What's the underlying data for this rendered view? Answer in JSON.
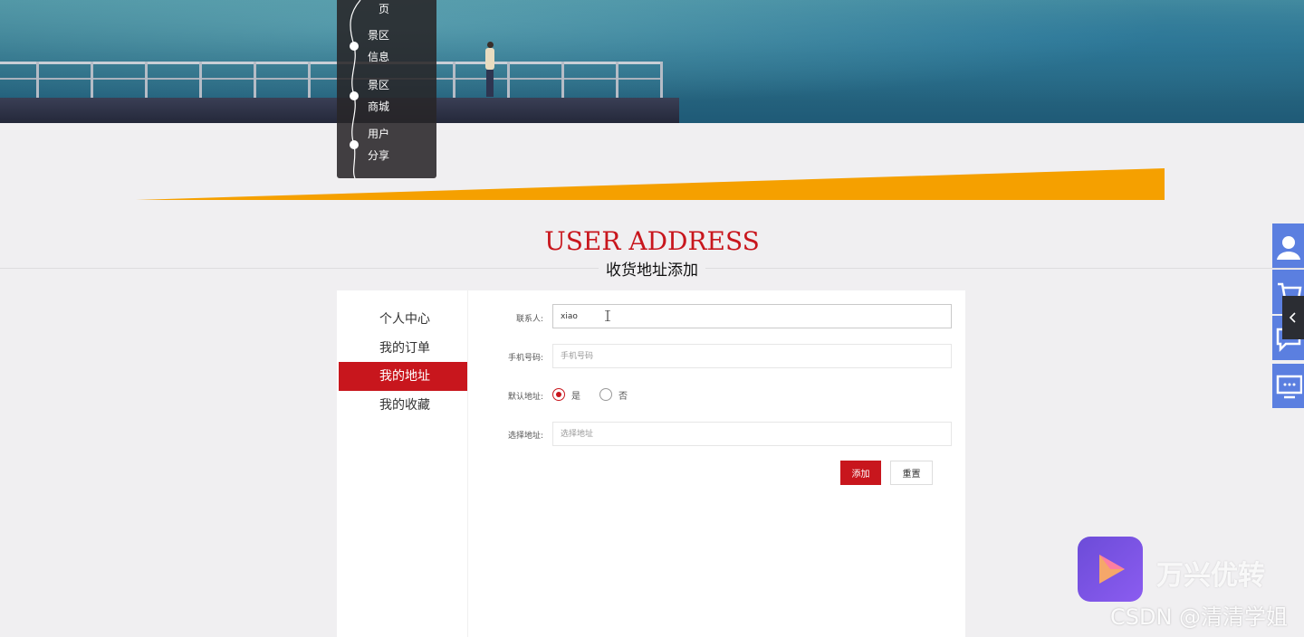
{
  "nav": {
    "items": [
      {
        "label_top": "页",
        "label_bottom": ""
      },
      {
        "label_top": "景区",
        "label_bottom": "信息"
      },
      {
        "label_top": "景区",
        "label_bottom": "商城"
      },
      {
        "label_top": "用户",
        "label_bottom": "分享"
      }
    ]
  },
  "section": {
    "title_en": "USER ADDRESS",
    "title_cn": "收货地址添加"
  },
  "menu": {
    "items": [
      "个人中心",
      "我的订单",
      "我的地址",
      "我的收藏"
    ],
    "active": "我的地址"
  },
  "form": {
    "contact": {
      "label": "联系人:",
      "value": "xiao",
      "placeholder": ""
    },
    "phone": {
      "label": "手机号码:",
      "value": "",
      "placeholder": "手机号码"
    },
    "default": {
      "label": "默认地址:",
      "options": [
        "是",
        "否"
      ],
      "selected": "是"
    },
    "address": {
      "label": "选择地址:",
      "value": "",
      "placeholder": "选择地址"
    },
    "add_label": "添加",
    "reset_label": "重置"
  },
  "float_toolbar": {
    "icons": [
      "user-icon",
      "cart-icon",
      "message-icon",
      "monitor-icon"
    ],
    "collapse_icon": "chevron-left-icon"
  },
  "watermark": {
    "app_name": "万兴优转",
    "csdn": "CSDN @清清学姐"
  },
  "colors": {
    "brand_red": "#c8161d",
    "accent_orange": "#f5a000",
    "float_blue": "#5b7fe0"
  }
}
